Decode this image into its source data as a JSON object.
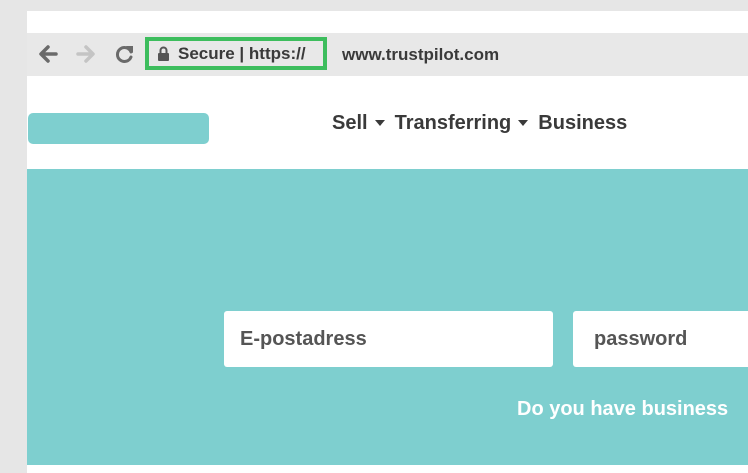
{
  "browser": {
    "secure_label": "Secure | https://",
    "url": "www.trustpilot.com",
    "icons": [
      "back-arrow-icon",
      "forward-arrow-icon",
      "reload-icon",
      "lock-icon"
    ],
    "highlight_color": "#3dbd5d"
  },
  "site": {
    "nav": {
      "sell_label": "Sell",
      "transferring_label": "Transferring",
      "business_label": "Business"
    },
    "login": {
      "email_placeholder": "E-postadress",
      "password_placeholder": "password",
      "business_prompt": "Do you have business"
    },
    "colors": {
      "accent": "#7ecfcf",
      "text": "#3a3a3a"
    }
  }
}
